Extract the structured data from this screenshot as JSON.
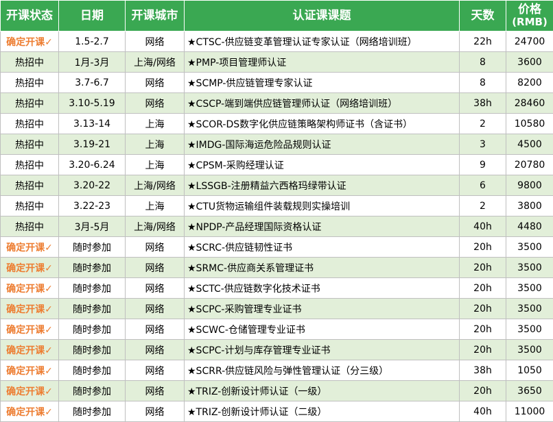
{
  "headers": [
    "开课状态",
    "日期",
    "开课城市",
    "认证课课题",
    "天数",
    "价格",
    "(RMB)"
  ],
  "rows": [
    {
      "status": "确定开课✓",
      "confirmed": true,
      "date": "1.5-2.7",
      "city": "网络",
      "title": "★CTSC-供应链变革管理认证专家认证（网络培训班）",
      "days": "22h",
      "price": "24700"
    },
    {
      "status": "热招中",
      "confirmed": false,
      "date": "1月-3月",
      "city": "上海/网络",
      "title": "★PMP-项目管理师认证",
      "days": "8",
      "price": "3600"
    },
    {
      "status": "热招中",
      "confirmed": false,
      "date": "3.7-6.7",
      "city": "网络",
      "title": "★SCMP-供应链管理专家认证",
      "days": "8",
      "price": "8200"
    },
    {
      "status": "热招中",
      "confirmed": false,
      "date": "3.10-5.19",
      "city": "网络",
      "title": "★CSCP-端到端供应链管理师认证（网络培训班）",
      "days": "38h",
      "price": "28460"
    },
    {
      "status": "热招中",
      "confirmed": false,
      "date": "3.13-14",
      "city": "上海",
      "title": "★SCOR-DS数字化供应链策略架构师证书（含证书）",
      "days": "2",
      "price": "10580"
    },
    {
      "status": "热招中",
      "confirmed": false,
      "date": "3.19-21",
      "city": "上海",
      "title": "★IMDG-国际海运危险品规则认证",
      "days": "3",
      "price": "4500"
    },
    {
      "status": "热招中",
      "confirmed": false,
      "date": "3.20-6.24",
      "city": "上海",
      "title": "★CPSM-采购经理认证",
      "days": "9",
      "price": "20780"
    },
    {
      "status": "热招中",
      "confirmed": false,
      "date": "3.20-22",
      "city": "上海/网络",
      "title": "★LSSGB-注册精益六西格玛绿带认证",
      "days": "6",
      "price": "9800"
    },
    {
      "status": "热招中",
      "confirmed": false,
      "date": "3.22-23",
      "city": "上海",
      "title": "★CTU货物运输组件装载规则实操培训",
      "days": "2",
      "price": "3800"
    },
    {
      "status": "热招中",
      "confirmed": false,
      "date": "3月-5月",
      "city": "上海/网络",
      "title": "★NPDP-产品经理国际资格认证",
      "days": "40h",
      "price": "4480"
    },
    {
      "status": "确定开课✓",
      "confirmed": true,
      "date": "随时参加",
      "city": "网络",
      "title": "★SCRC-供应链韧性证书",
      "days": "20h",
      "price": "3500"
    },
    {
      "status": "确定开课✓",
      "confirmed": true,
      "date": "随时参加",
      "city": "网络",
      "title": "★SRMC-供应商关系管理证书",
      "days": "20h",
      "price": "3500"
    },
    {
      "status": "确定开课✓",
      "confirmed": true,
      "date": "随时参加",
      "city": "网络",
      "title": "★SCTC-供应链数字化技术证书",
      "days": "20h",
      "price": "3500"
    },
    {
      "status": "确定开课✓",
      "confirmed": true,
      "date": "随时参加",
      "city": "网络",
      "title": "★SCPC-采购管理专业证书",
      "days": "20h",
      "price": "3500"
    },
    {
      "status": "确定开课✓",
      "confirmed": true,
      "date": "随时参加",
      "city": "网络",
      "title": "★SCWC-仓储管理专业证书",
      "days": "20h",
      "price": "3500"
    },
    {
      "status": "确定开课✓",
      "confirmed": true,
      "date": "随时参加",
      "city": "网络",
      "title": "★SCPC-计划与库存管理专业证书",
      "days": "20h",
      "price": "3500"
    },
    {
      "status": "确定开课✓",
      "confirmed": true,
      "date": "随时参加",
      "city": "网络",
      "title": "★SCRR-供应链风险与弹性管理认证（分三级）",
      "days": "38h",
      "price": "1050"
    },
    {
      "status": "确定开课✓",
      "confirmed": true,
      "date": "随时参加",
      "city": "网络",
      "title": "★TRIZ-创新设计师认证（一级）",
      "days": "20h",
      "price": "3650"
    },
    {
      "status": "确定开课✓",
      "confirmed": true,
      "date": "随时参加",
      "city": "网络",
      "title": "★TRIZ-创新设计师认证（二级）",
      "days": "40h",
      "price": "11000"
    }
  ],
  "colors": {
    "header_bg": "#3aa852",
    "row_alt_bg": "#e2efd9",
    "confirmed_text": "#ed7d31"
  }
}
